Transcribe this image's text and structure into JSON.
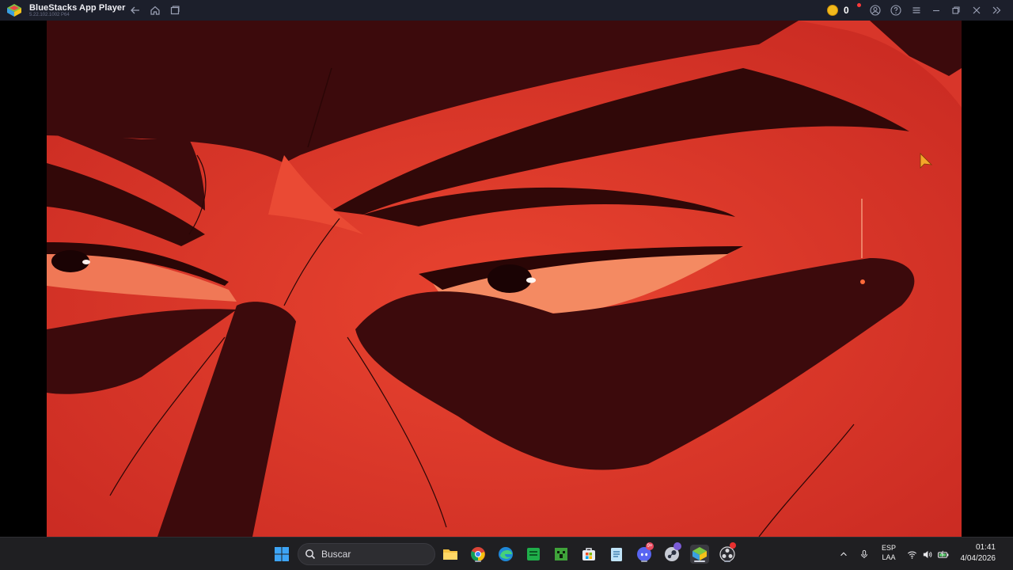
{
  "window": {
    "app_name": "BlueStacks App Player",
    "version": "5.22.102.1002 P64",
    "coins": "0",
    "icons": [
      "back-icon",
      "home-icon",
      "multi-instance-icon",
      "coin-icon",
      "account-icon",
      "help-icon",
      "menu-icon",
      "minimize-icon",
      "restore-icon",
      "close-icon",
      "expand-sidebar-icon"
    ]
  },
  "game": {
    "content": "anime close-up, angry eyes, red tint"
  },
  "taskbar": {
    "search_placeholder": "Buscar",
    "apps": [
      "windows-start",
      "file-explorer",
      "chrome",
      "edge",
      "spreadsheet",
      "minecraft",
      "store",
      "notepad",
      "discord",
      "steam",
      "bluestacks",
      "obs"
    ],
    "discord_badge": "9+",
    "language": "ESP",
    "layout": "LAA",
    "time": "01:41",
    "date": "4/04/2026"
  },
  "colors": {
    "titlebar": "#1c1f2b",
    "taskbar": "#1f1f22",
    "scene_red": "#d8362a",
    "scene_dark": "#3a0808"
  }
}
